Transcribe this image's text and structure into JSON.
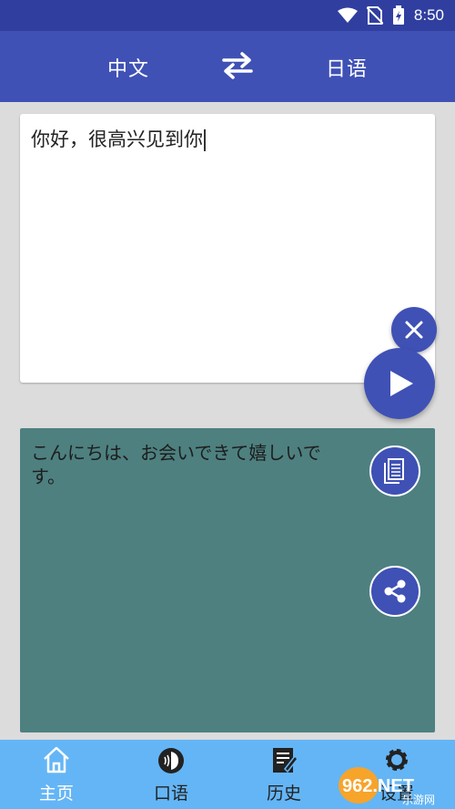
{
  "status_bar": {
    "time": "8:50",
    "icons": [
      "wifi-icon",
      "no-sim-icon",
      "battery-charging-icon"
    ]
  },
  "app_bar": {
    "source_language": "中文",
    "target_language": "日语",
    "swap_icon": "swap-arrows-icon"
  },
  "input": {
    "text": "你好，很高兴见到你",
    "clear_icon": "close-icon",
    "send_icon": "play-icon"
  },
  "result": {
    "text": "こんにちは、お会いできて嬉しいです。",
    "copy_icon": "copy-icon",
    "share_icon": "share-icon"
  },
  "bottom_nav": {
    "items": [
      {
        "label": "主页",
        "icon": "home-icon",
        "active": true
      },
      {
        "label": "口语",
        "icon": "speaking-icon",
        "active": false
      },
      {
        "label": "历史",
        "icon": "history-edit-icon",
        "active": false
      },
      {
        "label": "设置",
        "icon": "gear-icon",
        "active": false
      }
    ]
  },
  "watermark": {
    "text": "962.NET",
    "subtext": "乐游网"
  },
  "colors": {
    "primary": "#3f51b5",
    "primary_dark": "#303f9f",
    "result_bg": "#4e8080",
    "nav_bg": "#64b5f6",
    "page_bg": "#dcdcdc"
  }
}
